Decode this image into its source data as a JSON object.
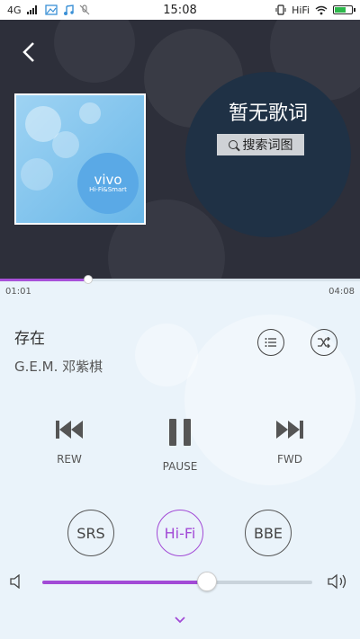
{
  "status_bar": {
    "network": "4G",
    "time": "15:08",
    "hifi": "HiFi",
    "battery_level": 0.7,
    "battery_color": "#2db84b"
  },
  "album": {
    "logo_text": "vivo",
    "logo_subtext": "Hi-Fi&Smart"
  },
  "lyrics": {
    "no_lyrics": "暂无歌词",
    "search_button": "搜索词图"
  },
  "progress": {
    "current": "01:01",
    "total": "04:08",
    "fraction": 0.246,
    "color": "#a851d9"
  },
  "song": {
    "title": "存在",
    "artist": "G.E.M. 邓紫棋"
  },
  "controls": {
    "rew": "REW",
    "pause": "PAUSE",
    "fwd": "FWD"
  },
  "effects": {
    "srs": "SRS",
    "hifi": "Hi-Fi",
    "bbe": "BBE",
    "accent": "#a24ad6"
  },
  "volume": {
    "level": 0.61
  }
}
